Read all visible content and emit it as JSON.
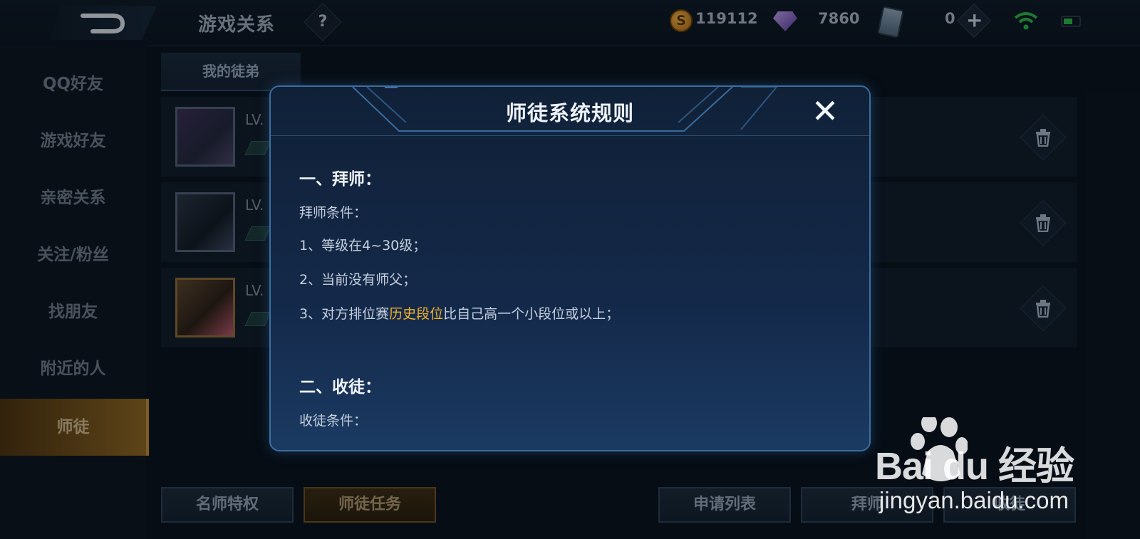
{
  "header": {
    "title": "游戏关系",
    "help": "?",
    "gold_amount": "119112",
    "diamond_amount": "7860",
    "ticket_amount": "0",
    "gold_coin_symbol": "S"
  },
  "sidebar": {
    "items": [
      {
        "label": "QQ好友"
      },
      {
        "label": "游戏好友"
      },
      {
        "label": "亲密关系"
      },
      {
        "label": "关注/粉丝"
      },
      {
        "label": "找朋友"
      },
      {
        "label": "附近的人"
      },
      {
        "label": "师徒"
      }
    ]
  },
  "main": {
    "tab": "我的徒弟",
    "level_prefix": "LV.",
    "bottom_buttons": [
      "名师特权",
      "师徒任务",
      "申请列表",
      "拜师",
      "收徒"
    ]
  },
  "dialog": {
    "title": "师徒系统规则",
    "close": "✕",
    "sections": {
      "s1_title": "一、拜师：",
      "s1_cond": "拜师条件：",
      "s1_item1": "1、等级在4~30级；",
      "s1_item2": "2、当前没有师父；",
      "s1_item3_pre": "3、对方排位赛",
      "s1_item3_hl": "历史段位",
      "s1_item3_post": "比自己高一个小段位或以上；",
      "s2_title": "二、收徒：",
      "s2_cond": "收徒条件："
    }
  },
  "watermark": {
    "text": "Bai du 经验",
    "url": "jingyan.baidu.com"
  }
}
